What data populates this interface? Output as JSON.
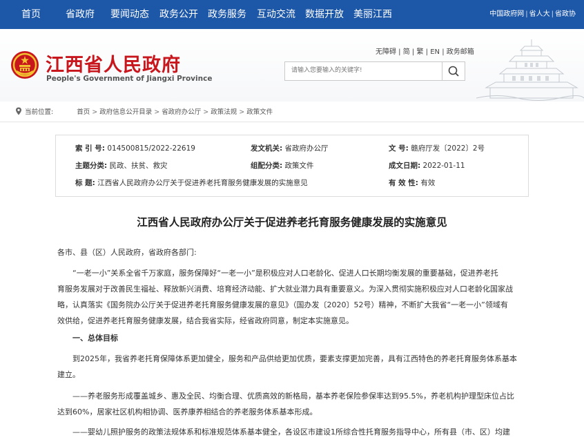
{
  "topnav": {
    "items": [
      "首页",
      "省政府",
      "要闻动态",
      "政务公开",
      "政务服务",
      "互动交流",
      "数据开放",
      "美丽江西"
    ],
    "right_links": [
      "中国政府网",
      "省人大",
      "省政协"
    ]
  },
  "header": {
    "title": "江西省人民政府",
    "subtitle": "People's Government of Jiangxi Province",
    "util_links": [
      "无障碍",
      "简",
      "繁",
      "EN",
      "政务邮箱"
    ],
    "search_placeholder": "请输入您要输入的关键字!"
  },
  "breadcrumb": {
    "label": "当前位置:",
    "items": [
      "首页",
      "政府信息公开目录",
      "省政府办公厅",
      "政策法规",
      "政策文件"
    ]
  },
  "meta": {
    "index_label": "索  引  号:",
    "index_value": "014500815/2022-22619",
    "issuer_label": "发文机关:",
    "issuer_value": "省政府办公厅",
    "docno_label": "文      号:",
    "docno_value": "赣府厅发〔2022〕2号",
    "topic_label": "主题分类:",
    "topic_value": "民政、扶贫、救灾",
    "category_label": "组配分类:",
    "category_value": "政策文件",
    "date_label": "成文日期:",
    "date_value": "2022-01-11",
    "title_label": "标      题:",
    "title_value": "江西省人民政府办公厅关于促进养老托育服务健康发展的实施意见",
    "validity_label": "有 效 性:",
    "validity_value": "有效"
  },
  "document": {
    "title": "江西省人民政府办公厅关于促进养老托育服务健康发展的实施意见",
    "salutation": "各市、县（区）人民政府，省政府各部门:",
    "para1_lines": [
      "“一老一小”关系全省千万家庭，服务保障好“一老一小”是积极应对人口老龄化、促进人口长期均衡发展的重要基础，促进养老托",
      "育服务发展对于改善民生福祉、释放新兴消费、培育经济动能、扩大就业潜力具有重要意义。为深入贯彻实施积极应对人口老龄化国家战",
      "略，认真落实《国务院办公厅关于促进养老托育服务健康发展的意见》（国办发〔2020〕52号）精神，不断扩大我省“一老一小”领域有",
      "效供给，促进养老托育服务健康发展，结合我省实际，经省政府同意，制定本实施意见。"
    ],
    "section1": "一、总体目标",
    "para2_lines": [
      "到2025年，我省养老托育保障体系更加健全，服务和产品供给更加优质，要素支撑更加完善，具有江西特色的养老托育服务体系基本",
      "建立。"
    ],
    "para3_lines": [
      "——养老服务形成覆盖城乡、惠及全民、均衡合理、优质高效的新格局，基本养老保险参保率达到95.5%，养老机构护理型床位占比",
      "达到60%，居家社区机构相协调、医养康养相结合的养老服务体系基本形成。"
    ],
    "para4_lines": [
      "——婴幼儿照护服务的政策法规体系和标准规范体系基本健全，各设区市建设1所综合性托育服务指导中心，所有县（市、区）均建"
    ]
  }
}
